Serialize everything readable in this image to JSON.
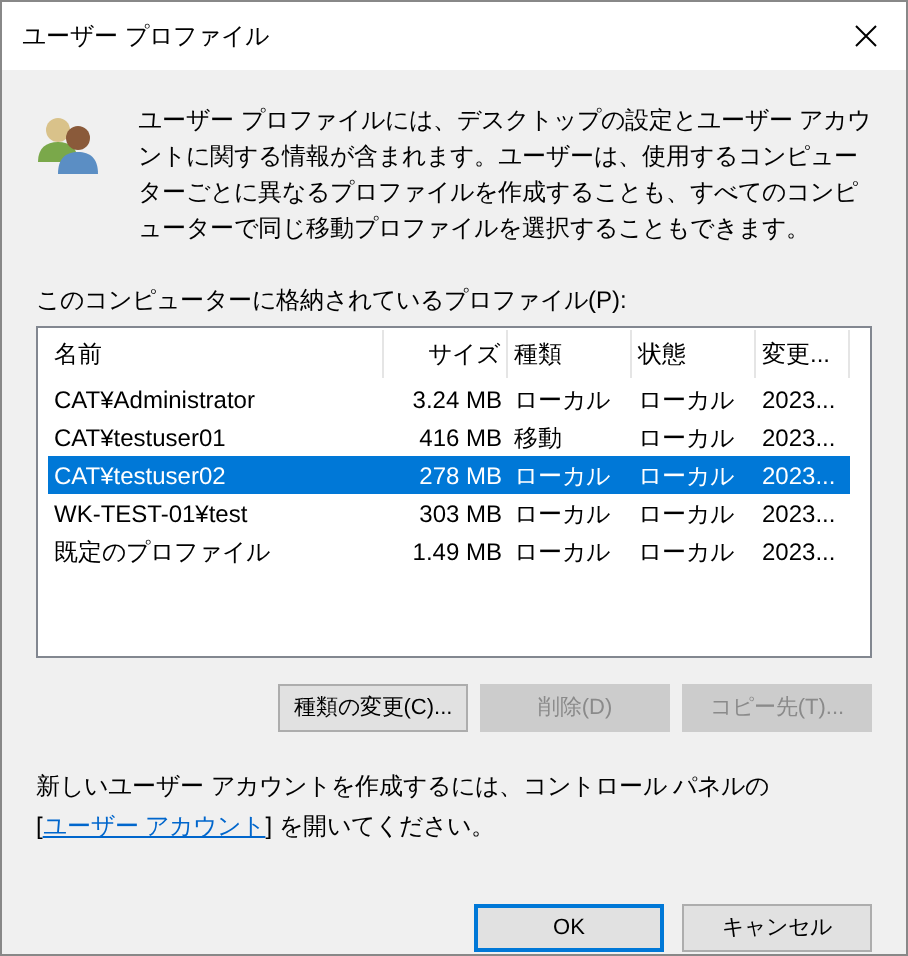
{
  "window": {
    "title": "ユーザー プロファイル"
  },
  "description": "ユーザー プロファイルには、デスクトップの設定とユーザー アカウントに関する情報が含まれます。ユーザーは、使用するコンピューターごとに異なるプロファイルを作成することも、すべてのコンピューターで同じ移動プロファイルを選択することもできます。",
  "list_label": "このコンピューターに格納されているプロファイル(P):",
  "table": {
    "columns": [
      {
        "label": "名前",
        "kind": "text"
      },
      {
        "label": "サイズ",
        "kind": "number"
      },
      {
        "label": "種類",
        "kind": "text"
      },
      {
        "label": "状態",
        "kind": "text"
      },
      {
        "label": "変更...",
        "kind": "text"
      }
    ],
    "rows": [
      {
        "cells": [
          "CAT¥Administrator",
          "3.24 MB",
          "ローカル",
          "ローカル",
          "2023..."
        ],
        "selected": false
      },
      {
        "cells": [
          "CAT¥testuser01",
          "416 MB",
          "移動",
          "ローカル",
          "2023..."
        ],
        "selected": false
      },
      {
        "cells": [
          "CAT¥testuser02",
          "278 MB",
          "ローカル",
          "ローカル",
          "2023..."
        ],
        "selected": true
      },
      {
        "cells": [
          "WK-TEST-01¥test",
          "303 MB",
          "ローカル",
          "ローカル",
          "2023..."
        ],
        "selected": false
      },
      {
        "cells": [
          "既定のプロファイル",
          "1.49 MB",
          "ローカル",
          "ローカル",
          "2023..."
        ],
        "selected": false
      }
    ]
  },
  "actions": [
    {
      "label": "種類の変更(C)...",
      "disabled": false
    },
    {
      "label": "削除(D)",
      "disabled": true
    },
    {
      "label": "コピー先(T)...",
      "disabled": true
    }
  ],
  "footer": {
    "text": "新しいユーザー アカウントを作成するには、コントロール パネルの",
    "link_prefix": "[",
    "link": "ユーザー アカウント",
    "link_suffix": "] を開いてください。"
  },
  "buttons": [
    {
      "label": "OK",
      "default": true
    },
    {
      "label": "キャンセル",
      "default": false
    }
  ]
}
